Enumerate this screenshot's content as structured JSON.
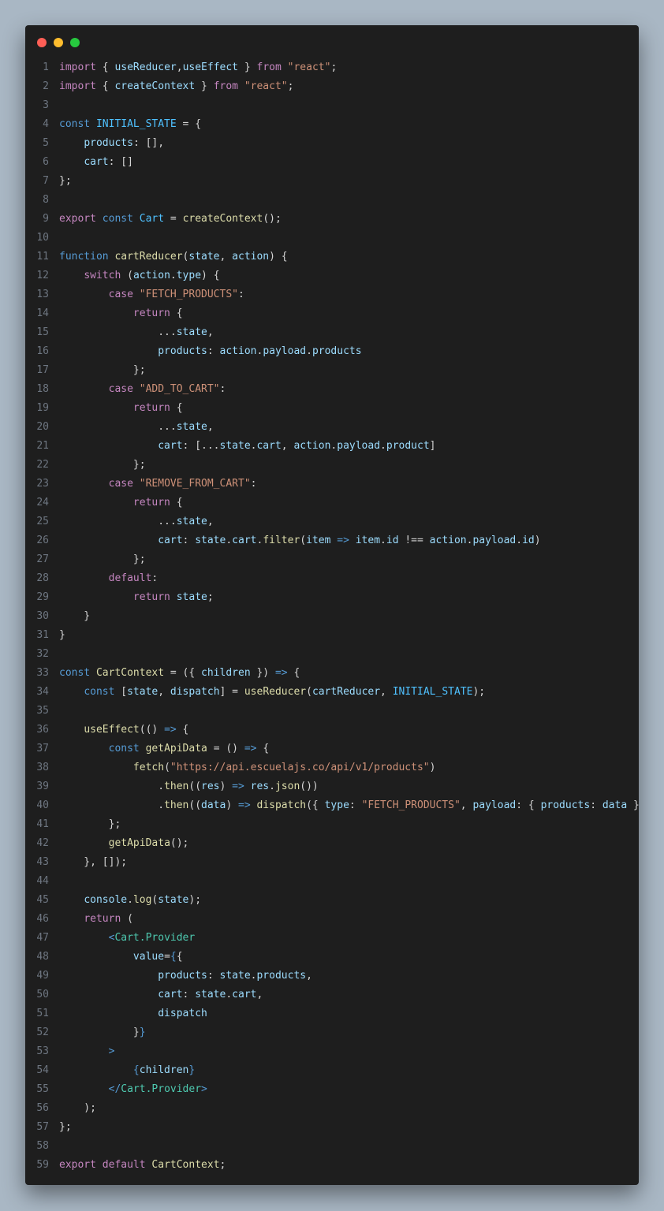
{
  "window": {
    "controls": [
      "close",
      "minimize",
      "maximize"
    ]
  },
  "code": {
    "lines": [
      [
        [
          "kw",
          "import"
        ],
        [
          "pu",
          " { "
        ],
        [
          "vr",
          "useReducer"
        ],
        [
          "pu",
          ","
        ],
        [
          "vr",
          "useEffect"
        ],
        [
          "pu",
          " } "
        ],
        [
          "kw",
          "from"
        ],
        [
          "pu",
          " "
        ],
        [
          "st",
          "\"react\""
        ],
        [
          "pu",
          ";"
        ]
      ],
      [
        [
          "kw",
          "import"
        ],
        [
          "pu",
          " { "
        ],
        [
          "vr",
          "createContext"
        ],
        [
          "pu",
          " } "
        ],
        [
          "kw",
          "from"
        ],
        [
          "pu",
          " "
        ],
        [
          "st",
          "\"react\""
        ],
        [
          "pu",
          ";"
        ]
      ],
      [],
      [
        [
          "dk",
          "const"
        ],
        [
          "pu",
          " "
        ],
        [
          "cn",
          "INITIAL_STATE"
        ],
        [
          "pu",
          " = {"
        ]
      ],
      [
        [
          "pu",
          "    "
        ],
        [
          "vr",
          "products"
        ],
        [
          "pu",
          ": [],"
        ]
      ],
      [
        [
          "pu",
          "    "
        ],
        [
          "vr",
          "cart"
        ],
        [
          "pu",
          ": []"
        ]
      ],
      [
        [
          "pu",
          "};"
        ]
      ],
      [],
      [
        [
          "kw",
          "export"
        ],
        [
          "pu",
          " "
        ],
        [
          "dk",
          "const"
        ],
        [
          "pu",
          " "
        ],
        [
          "cn",
          "Cart"
        ],
        [
          "pu",
          " = "
        ],
        [
          "fn",
          "createContext"
        ],
        [
          "pu",
          "();"
        ]
      ],
      [],
      [
        [
          "dk",
          "function"
        ],
        [
          "pu",
          " "
        ],
        [
          "fn",
          "cartReducer"
        ],
        [
          "pu",
          "("
        ],
        [
          "vr",
          "state"
        ],
        [
          "pu",
          ", "
        ],
        [
          "vr",
          "action"
        ],
        [
          "pu",
          ") {"
        ]
      ],
      [
        [
          "pu",
          "    "
        ],
        [
          "kw",
          "switch"
        ],
        [
          "pu",
          " ("
        ],
        [
          "vr",
          "action"
        ],
        [
          "pu",
          "."
        ],
        [
          "vr",
          "type"
        ],
        [
          "pu",
          ") {"
        ]
      ],
      [
        [
          "pu",
          "        "
        ],
        [
          "kw",
          "case"
        ],
        [
          "pu",
          " "
        ],
        [
          "st",
          "\"FETCH_PRODUCTS\""
        ],
        [
          "pu",
          ":"
        ]
      ],
      [
        [
          "pu",
          "            "
        ],
        [
          "kw",
          "return"
        ],
        [
          "pu",
          " {"
        ]
      ],
      [
        [
          "pu",
          "                ..."
        ],
        [
          "vr",
          "state"
        ],
        [
          "pu",
          ","
        ]
      ],
      [
        [
          "pu",
          "                "
        ],
        [
          "vr",
          "products"
        ],
        [
          "pu",
          ": "
        ],
        [
          "vr",
          "action"
        ],
        [
          "pu",
          "."
        ],
        [
          "vr",
          "payload"
        ],
        [
          "pu",
          "."
        ],
        [
          "vr",
          "products"
        ]
      ],
      [
        [
          "pu",
          "            };"
        ]
      ],
      [
        [
          "pu",
          "        "
        ],
        [
          "kw",
          "case"
        ],
        [
          "pu",
          " "
        ],
        [
          "st",
          "\"ADD_TO_CART\""
        ],
        [
          "pu",
          ":"
        ]
      ],
      [
        [
          "pu",
          "            "
        ],
        [
          "kw",
          "return"
        ],
        [
          "pu",
          " {"
        ]
      ],
      [
        [
          "pu",
          "                ..."
        ],
        [
          "vr",
          "state"
        ],
        [
          "pu",
          ","
        ]
      ],
      [
        [
          "pu",
          "                "
        ],
        [
          "vr",
          "cart"
        ],
        [
          "pu",
          ": [..."
        ],
        [
          "vr",
          "state"
        ],
        [
          "pu",
          "."
        ],
        [
          "vr",
          "cart"
        ],
        [
          "pu",
          ", "
        ],
        [
          "vr",
          "action"
        ],
        [
          "pu",
          "."
        ],
        [
          "vr",
          "payload"
        ],
        [
          "pu",
          "."
        ],
        [
          "vr",
          "product"
        ],
        [
          "pu",
          "]"
        ]
      ],
      [
        [
          "pu",
          "            };"
        ]
      ],
      [
        [
          "pu",
          "        "
        ],
        [
          "kw",
          "case"
        ],
        [
          "pu",
          " "
        ],
        [
          "st",
          "\"REMOVE_FROM_CART\""
        ],
        [
          "pu",
          ":"
        ]
      ],
      [
        [
          "pu",
          "            "
        ],
        [
          "kw",
          "return"
        ],
        [
          "pu",
          " {"
        ]
      ],
      [
        [
          "pu",
          "                ..."
        ],
        [
          "vr",
          "state"
        ],
        [
          "pu",
          ","
        ]
      ],
      [
        [
          "pu",
          "                "
        ],
        [
          "vr",
          "cart"
        ],
        [
          "pu",
          ": "
        ],
        [
          "vr",
          "state"
        ],
        [
          "pu",
          "."
        ],
        [
          "vr",
          "cart"
        ],
        [
          "pu",
          "."
        ],
        [
          "fn",
          "filter"
        ],
        [
          "pu",
          "("
        ],
        [
          "vr",
          "item"
        ],
        [
          "pu",
          " "
        ],
        [
          "ar",
          "=>"
        ],
        [
          "pu",
          " "
        ],
        [
          "vr",
          "item"
        ],
        [
          "pu",
          "."
        ],
        [
          "vr",
          "id"
        ],
        [
          "pu",
          " !== "
        ],
        [
          "vr",
          "action"
        ],
        [
          "pu",
          "."
        ],
        [
          "vr",
          "payload"
        ],
        [
          "pu",
          "."
        ],
        [
          "vr",
          "id"
        ],
        [
          "pu",
          ")"
        ]
      ],
      [
        [
          "pu",
          "            };"
        ]
      ],
      [
        [
          "pu",
          "        "
        ],
        [
          "kw",
          "default"
        ],
        [
          "pu",
          ":"
        ]
      ],
      [
        [
          "pu",
          "            "
        ],
        [
          "kw",
          "return"
        ],
        [
          "pu",
          " "
        ],
        [
          "vr",
          "state"
        ],
        [
          "pu",
          ";"
        ]
      ],
      [
        [
          "pu",
          "    }"
        ]
      ],
      [
        [
          "pu",
          "}"
        ]
      ],
      [],
      [
        [
          "dk",
          "const"
        ],
        [
          "pu",
          " "
        ],
        [
          "fn",
          "CartContext"
        ],
        [
          "pu",
          " = ({ "
        ],
        [
          "vr",
          "children"
        ],
        [
          "pu",
          " }) "
        ],
        [
          "ar",
          "=>"
        ],
        [
          "pu",
          " {"
        ]
      ],
      [
        [
          "pu",
          "    "
        ],
        [
          "dk",
          "const"
        ],
        [
          "pu",
          " ["
        ],
        [
          "vr",
          "state"
        ],
        [
          "pu",
          ", "
        ],
        [
          "vr",
          "dispatch"
        ],
        [
          "pu",
          "] = "
        ],
        [
          "fn",
          "useReducer"
        ],
        [
          "pu",
          "("
        ],
        [
          "vr",
          "cartReducer"
        ],
        [
          "pu",
          ", "
        ],
        [
          "cn",
          "INITIAL_STATE"
        ],
        [
          "pu",
          ");"
        ]
      ],
      [],
      [
        [
          "pu",
          "    "
        ],
        [
          "fn",
          "useEffect"
        ],
        [
          "pu",
          "(() "
        ],
        [
          "ar",
          "=>"
        ],
        [
          "pu",
          " {"
        ]
      ],
      [
        [
          "pu",
          "        "
        ],
        [
          "dk",
          "const"
        ],
        [
          "pu",
          " "
        ],
        [
          "fn",
          "getApiData"
        ],
        [
          "pu",
          " = () "
        ],
        [
          "ar",
          "=>"
        ],
        [
          "pu",
          " {"
        ]
      ],
      [
        [
          "pu",
          "            "
        ],
        [
          "fn",
          "fetch"
        ],
        [
          "pu",
          "("
        ],
        [
          "st",
          "\"https://api.escuelajs.co/api/v1/products\""
        ],
        [
          "pu",
          ")"
        ]
      ],
      [
        [
          "pu",
          "                ."
        ],
        [
          "fn",
          "then"
        ],
        [
          "pu",
          "(("
        ],
        [
          "vr",
          "res"
        ],
        [
          "pu",
          ") "
        ],
        [
          "ar",
          "=>"
        ],
        [
          "pu",
          " "
        ],
        [
          "vr",
          "res"
        ],
        [
          "pu",
          "."
        ],
        [
          "fn",
          "json"
        ],
        [
          "pu",
          "())"
        ]
      ],
      [
        [
          "pu",
          "                ."
        ],
        [
          "fn",
          "then"
        ],
        [
          "pu",
          "(("
        ],
        [
          "vr",
          "data"
        ],
        [
          "pu",
          ") "
        ],
        [
          "ar",
          "=>"
        ],
        [
          "pu",
          " "
        ],
        [
          "fn",
          "dispatch"
        ],
        [
          "pu",
          "({ "
        ],
        [
          "vr",
          "type"
        ],
        [
          "pu",
          ": "
        ],
        [
          "st",
          "\"FETCH_PRODUCTS\""
        ],
        [
          "pu",
          ", "
        ],
        [
          "vr",
          "payload"
        ],
        [
          "pu",
          ": { "
        ],
        [
          "vr",
          "products"
        ],
        [
          "pu",
          ": "
        ],
        [
          "vr",
          "data"
        ],
        [
          "pu",
          " }}));"
        ]
      ],
      [
        [
          "pu",
          "        };"
        ]
      ],
      [
        [
          "pu",
          "        "
        ],
        [
          "fn",
          "getApiData"
        ],
        [
          "pu",
          "();"
        ]
      ],
      [
        [
          "pu",
          "    }, []);"
        ]
      ],
      [],
      [
        [
          "pu",
          "    "
        ],
        [
          "vr",
          "console"
        ],
        [
          "pu",
          "."
        ],
        [
          "fn",
          "log"
        ],
        [
          "pu",
          "("
        ],
        [
          "vr",
          "state"
        ],
        [
          "pu",
          ");"
        ]
      ],
      [
        [
          "pu",
          "    "
        ],
        [
          "kw",
          "return"
        ],
        [
          "pu",
          " ("
        ]
      ],
      [
        [
          "pu",
          "        "
        ],
        [
          "br",
          "<"
        ],
        [
          "tg",
          "Cart.Provider"
        ]
      ],
      [
        [
          "pu",
          "            "
        ],
        [
          "vr",
          "value"
        ],
        [
          "pu",
          "="
        ],
        [
          "br",
          "{"
        ],
        [
          "pu",
          "{"
        ]
      ],
      [
        [
          "pu",
          "                "
        ],
        [
          "vr",
          "products"
        ],
        [
          "pu",
          ": "
        ],
        [
          "vr",
          "state"
        ],
        [
          "pu",
          "."
        ],
        [
          "vr",
          "products"
        ],
        [
          "pu",
          ","
        ]
      ],
      [
        [
          "pu",
          "                "
        ],
        [
          "vr",
          "cart"
        ],
        [
          "pu",
          ": "
        ],
        [
          "vr",
          "state"
        ],
        [
          "pu",
          "."
        ],
        [
          "vr",
          "cart"
        ],
        [
          "pu",
          ","
        ]
      ],
      [
        [
          "pu",
          "                "
        ],
        [
          "vr",
          "dispatch"
        ]
      ],
      [
        [
          "pu",
          "            }"
        ],
        [
          "br",
          "}"
        ]
      ],
      [
        [
          "pu",
          "        "
        ],
        [
          "br",
          ">"
        ]
      ],
      [
        [
          "pu",
          "            "
        ],
        [
          "br",
          "{"
        ],
        [
          "vr",
          "children"
        ],
        [
          "br",
          "}"
        ]
      ],
      [
        [
          "pu",
          "        "
        ],
        [
          "br",
          "</"
        ],
        [
          "tg",
          "Cart.Provider"
        ],
        [
          "br",
          ">"
        ]
      ],
      [
        [
          "pu",
          "    );"
        ]
      ],
      [
        [
          "pu",
          "};"
        ]
      ],
      [],
      [
        [
          "kw",
          "export"
        ],
        [
          "pu",
          " "
        ],
        [
          "kw",
          "default"
        ],
        [
          "pu",
          " "
        ],
        [
          "fn",
          "CartContext"
        ],
        [
          "pu",
          ";"
        ]
      ]
    ]
  }
}
